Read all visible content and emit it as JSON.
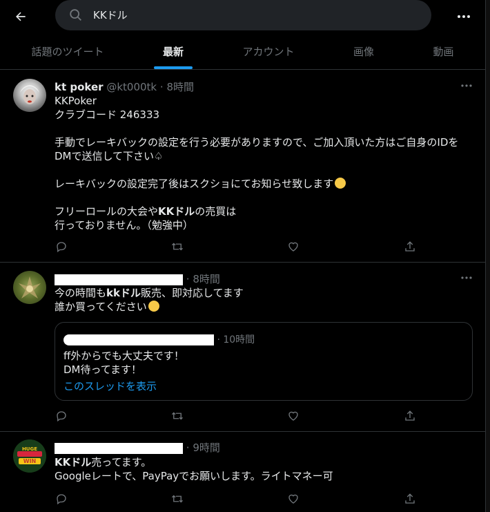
{
  "search": {
    "query": "KKドル"
  },
  "tabs": [
    {
      "label": "話題のツイート"
    },
    {
      "label": "最新"
    },
    {
      "label": "アカウント"
    },
    {
      "label": "画像"
    },
    {
      "label": "動画"
    }
  ],
  "tweets": [
    {
      "name": "kt poker",
      "handle": "@kt000tk",
      "time": "8時間",
      "lines": [
        "KKPoker",
        "クラブコード 246333",
        "",
        "手動でレーキバックの設定を行う必要がありますので、ご加入頂いた方はご自身のIDを",
        "DMで送信して下さい♤",
        "",
        "レーキバックの設定完了後はスクショにてお知らせ致します",
        "",
        "フリーロールの大会や",
        "KKドル",
        "の売買は",
        "行っておりません。（勉強中）"
      ]
    },
    {
      "time": "8時間",
      "line1_a": "今の時間も",
      "line1_b": "kkドル",
      "line1_c": "販売、即対応してます",
      "line2": "誰か買ってください",
      "quote": {
        "time": "10時間",
        "line1": "ff外からでも大丈夫です！",
        "line2": "DM待ってます！",
        "link": "このスレッドを表示"
      }
    },
    {
      "time": "9時間",
      "avatar_text_1": "HUGE",
      "avatar_text_2": "WIN",
      "line1_a": "KKドル",
      "line1_b": "売ってます。",
      "line2": "Googleレートで、PayPayでお願いします。ライトマネー可"
    }
  ],
  "colors": {
    "background": "#000000",
    "accent": "#1d9bf0",
    "text": "#e7e9ea",
    "muted": "#71767b",
    "border": "#2f3336"
  }
}
